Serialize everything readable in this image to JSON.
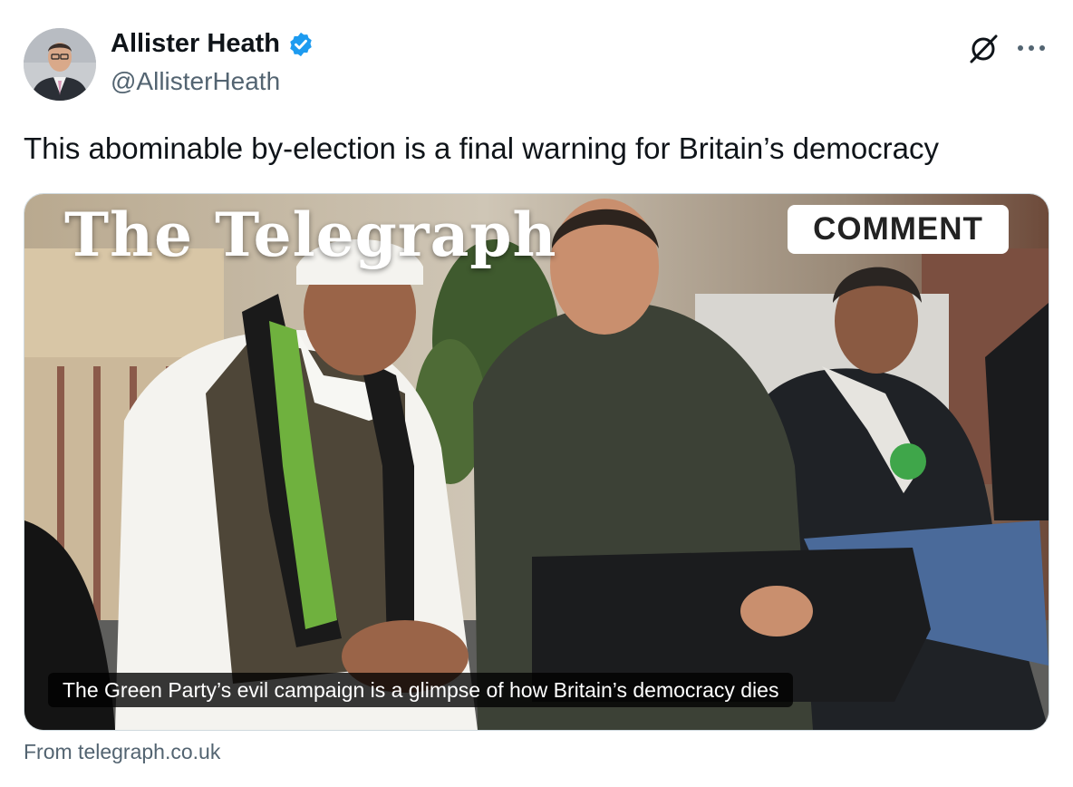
{
  "author": {
    "display_name": "Allister Heath",
    "handle": "@AllisterHeath",
    "verified": true
  },
  "tweet": {
    "text": "This abominable by-election is a final warning for Britain’s democracy"
  },
  "card": {
    "masthead": "The Telegraph",
    "badge": "COMMENT",
    "headline": "The Green Party’s evil campaign is a glimpse of how Britain’s democracy dies",
    "source": "From telegraph.co.uk"
  },
  "icons": {
    "verified": "verified-badge-icon",
    "grok": "grok-icon",
    "more": "more-options-icon"
  },
  "colors": {
    "verified_blue": "#1d9bf0",
    "text_primary": "#0f1419",
    "text_secondary": "#536471",
    "card_border": "#cfd9de"
  }
}
